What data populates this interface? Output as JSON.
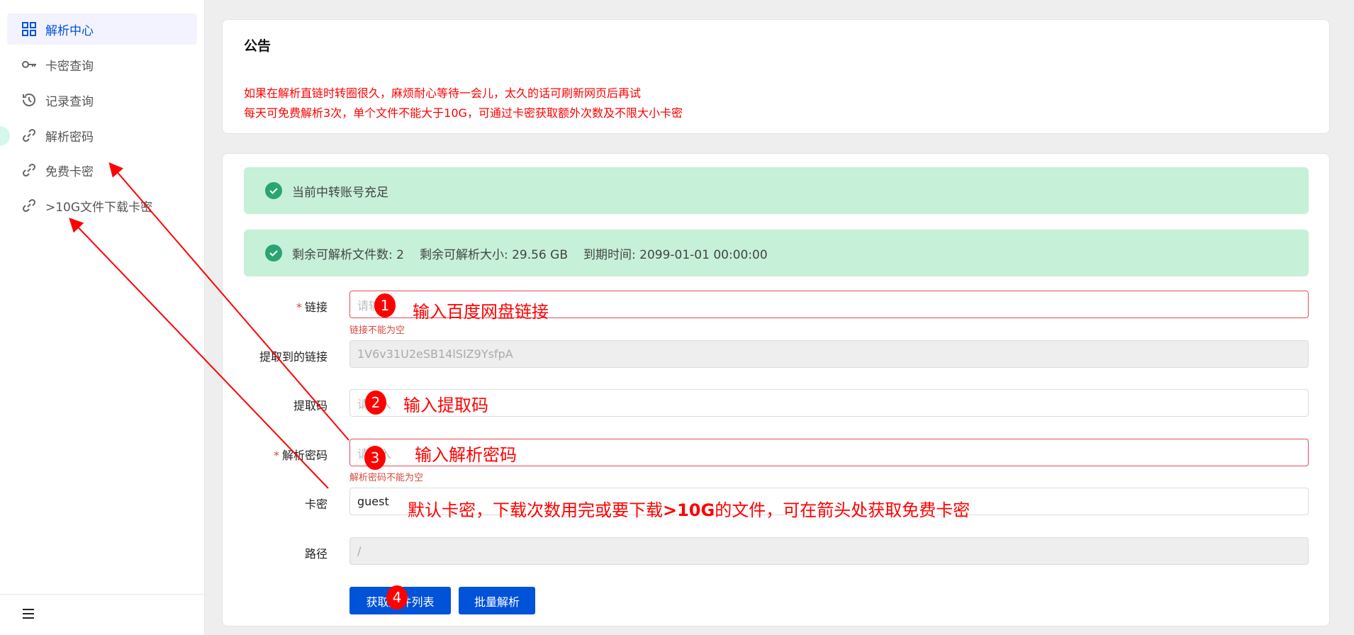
{
  "sidebar": {
    "items": [
      {
        "label": "解析中心",
        "icon": "grid-icon",
        "active": true
      },
      {
        "label": "卡密查询",
        "icon": "key-icon"
      },
      {
        "label": "记录查询",
        "icon": "history-icon"
      },
      {
        "label": "解析密码",
        "icon": "link-icon"
      },
      {
        "label": "免费卡密",
        "icon": "link-icon"
      },
      {
        "label": ">10G文件下载卡密",
        "icon": "link-icon"
      }
    ],
    "menu_icon": "hamburger-icon"
  },
  "notice": {
    "title": "公告",
    "lines": [
      "如果在解析直链时转圈很久，麻烦耐心等待一会儿，太久的话可刷新网页后再试",
      "每天可免费解析3次，单个文件不能大于10G，可通过卡密获取额外次数及不限大小卡密"
    ]
  },
  "alerts": {
    "status": "当前中转账号充足",
    "remaining_files": "剩余可解析文件数: 2",
    "remaining_size": "剩余可解析大小: 29.56 GB",
    "expiry": "到期时间: 2099-01-01 00:00:00"
  },
  "form": {
    "link": {
      "label": "链接",
      "placeholder": "请输入",
      "error": "链接不能为空"
    },
    "extracted": {
      "label": "提取到的链接",
      "value": "1V6v31U2eSB14lSIZ9YsfpA"
    },
    "code": {
      "label": "提取码",
      "placeholder": "请输入"
    },
    "password": {
      "label": "解析密码",
      "placeholder": "请输入",
      "error": "解析密码不能为空"
    },
    "card": {
      "label": "卡密",
      "value": "guest"
    },
    "path": {
      "label": "路径",
      "value": "/"
    },
    "buttons": {
      "get_list": "获取文件列表",
      "batch": "批量解析"
    }
  },
  "annotations": {
    "b1": "1",
    "t1": "输入百度网盘链接",
    "b2": "2",
    "t2": "输入提取码",
    "b3": "3",
    "t3": "输入解析密码",
    "b4": "4",
    "t5a": "默认卡密，下载次数用完或要下载",
    "t5b": ">10G",
    "t5c": "的文件，可在箭头处获取免费卡密",
    "color": "#ff0000"
  },
  "colors": {
    "primary": "#0052d9",
    "success_bg": "#c6f0d8",
    "success": "#2ba471",
    "error": "#d54941"
  }
}
